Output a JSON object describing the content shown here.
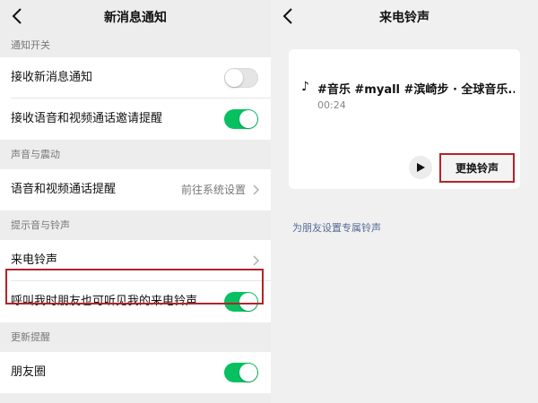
{
  "left": {
    "title": "新消息通知",
    "sections": {
      "notify": "通知开关",
      "sound": "声音与震动",
      "ring": "提示音与铃声",
      "update": "更新提醒"
    },
    "rows": {
      "receive_new": {
        "label": "接收新消息通知",
        "toggle": "off"
      },
      "voice_video_invite": {
        "label": "接收语音和视频通话邀请提醒",
        "toggle": "on"
      },
      "call_reminder": {
        "label": "语音和视频通话提醒",
        "value": "前往系统设置"
      },
      "ringtone": {
        "label": "来电铃声"
      },
      "friend_hear": {
        "label": "呼叫我时朋友也可听见我的来电铃声",
        "toggle": "on"
      },
      "moments": {
        "label": "朋友圈",
        "toggle": "on"
      }
    }
  },
  "right": {
    "title": "来电铃声",
    "song": {
      "title": "#音乐 #myall #滨崎步 · 全球音乐...",
      "duration": "00:24"
    },
    "change_label": "更换铃声",
    "friend_link": "为朋友设置专属铃声"
  },
  "icons": {
    "back": "chevron-left-icon",
    "chevron": "chevron-right-icon",
    "note": "music-note-icon",
    "play": "play-icon"
  },
  "colors": {
    "toggle_on": "#07c160",
    "highlight": "#b3232a",
    "link": "#576b95"
  }
}
